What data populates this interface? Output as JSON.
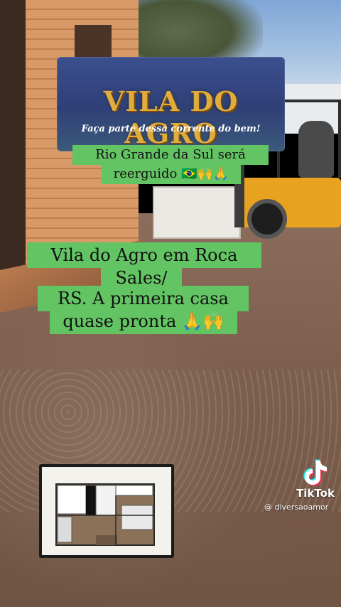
{
  "title_card": {
    "brand": "VILA DO AGRO",
    "tagline": "Faça parte dessa corrente do bem!"
  },
  "captions": {
    "line1": "Rio Grande da Sul será",
    "line2": "reerguido 🇧🇷🙌🙏",
    "line3": "Vila do Agro em Roca",
    "line4": "Sales/",
    "line5": "RS. A primeira casa",
    "line6": "quase pronta 🙏🙌"
  },
  "watermark": {
    "app_name": "TikTok",
    "handle": "@ diversaoamor"
  },
  "colors": {
    "caption_bg": "#63c463",
    "brand_gold": "#e0ad3d",
    "card_blue": "#2f4077"
  }
}
